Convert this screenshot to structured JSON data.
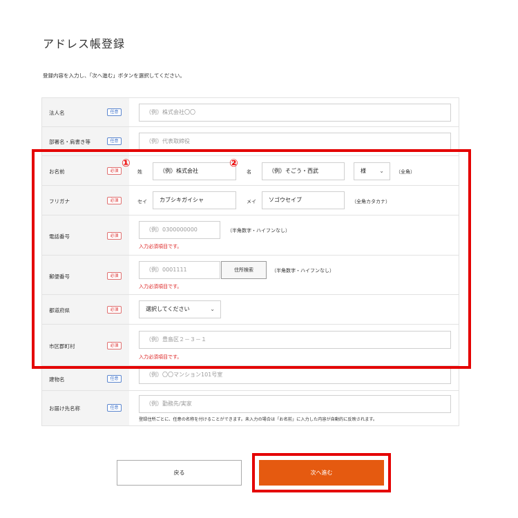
{
  "page": {
    "title": "アドレス帳登録",
    "instruction": "登録内容を入力し、「次へ進む」ボタンを選択してください。"
  },
  "badges": {
    "optional": "任意",
    "required": "必須"
  },
  "fields": {
    "company": {
      "label": "法人名",
      "placeholder": "（例）株式会社〇〇"
    },
    "department": {
      "label": "部署名・肩書き等",
      "placeholder": "（例）代表取締役"
    },
    "name": {
      "label": "お名前",
      "sei_prefix": "姓",
      "sei_value": "（例）株式会社",
      "mei_prefix": "名",
      "mei_value": "（例）そごう・西武",
      "honorific": "様",
      "note": "（全角）"
    },
    "furigana": {
      "label": "フリガナ",
      "sei_prefix": "セイ",
      "sei_value": "カブシキガイシャ",
      "mei_prefix": "メイ",
      "mei_value": "ソゴウセイブ",
      "note": "（全角カタカナ）"
    },
    "phone": {
      "label": "電話番号",
      "placeholder": "（例）0300000000",
      "note": "（半角数字・ハイフンなし）",
      "error": "入力必須項目です。"
    },
    "postal": {
      "label": "郵便番号",
      "placeholder": "（例）0001111",
      "search_button": "住所検索",
      "note": "（半角数字・ハイフンなし）",
      "error": "入力必須項目です。"
    },
    "prefecture": {
      "label": "都道府県",
      "selected": "選択してください"
    },
    "city": {
      "label": "市区郡町村",
      "placeholder": "（例）豊島区２－３－１",
      "error": "入力必須項目です。"
    },
    "building": {
      "label": "建物名",
      "placeholder": "（例）〇〇マンション101号室"
    },
    "delivery_name": {
      "label": "お届け先名称",
      "placeholder": "（例）勤務先/実家",
      "note": "登録住所ごとに、任意の名称を付けることができます。未入力の場合は「お名前」に入力した内容が自動的に反映されます。"
    }
  },
  "annotations": {
    "marker1": "①",
    "marker2": "②"
  },
  "buttons": {
    "back": "戻る",
    "next": "次へ進む"
  },
  "colors": {
    "highlight": "#e40000",
    "next_button": "#e55a10",
    "required": "#dd3333",
    "optional": "#3a6fc9"
  },
  "icons": {
    "chevron": "chevron-down-icon"
  }
}
